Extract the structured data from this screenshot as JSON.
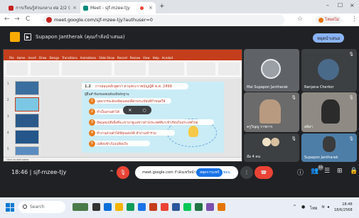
{
  "browser": {
    "tabs": [
      {
        "title": "การเรียนรู้ส่วนกลาง ต่อ 2/2 (ส่ว",
        "active": false,
        "close": "×"
      },
      {
        "title": "Meet - sjf-mzee-tjy",
        "active": true,
        "close": "×"
      }
    ],
    "new_tab": "+",
    "window_controls": {
      "minimize": "–",
      "maximize": "☐",
      "close": "×"
    },
    "back": "←",
    "forward": "→",
    "reload": "C",
    "url": "meet.google.com/sjf-mzee-tjy?authuser=0",
    "star": "☆",
    "profile_label": "โหมดไม่",
    "menu": "⋮"
  },
  "banner": {
    "presenter_text": "Supapon Jantherak (คุณกำลังนำเสนอ)",
    "stop_button": "หยุดนำเสนอ"
  },
  "presentation": {
    "window_title": "",
    "ribbon_tabs": [
      "File",
      "Home",
      "Insert",
      "Draw",
      "Design",
      "Transitions",
      "Animations",
      "Slide Show",
      "Record",
      "Review",
      "View",
      "Help",
      "Acrobat"
    ],
    "slide_number": "1.2",
    "slide_title": "การสอบหลักสูตรฯ ตามพระราชบัญญัติ พ.ศ. 2499",
    "slide_subtitle": "ผู้ยื่นคำร้องขอสอบต้องมีหลักฐาน",
    "items": [
      {
        "num": "1",
        "text": "บุคลากรจะต้องมีคุณสมบัติตามระเบียบที่กำหนดให้"
      },
      {
        "num": "2",
        "text": "ทำเป็นส่วนตัวได้"
      },
      {
        "num": "3",
        "text": "มีคุณสมบัติเพื่อที่จะเขามาดูแลชาวต่างประเทศที่มาเข้าเรียนในประเทศไทย"
      },
      {
        "num": "4",
        "text": "ทำงานส่วนตัวได้มีคุณสมบัติ ทำงานเข้าร่วม"
      },
      {
        "num": "5",
        "text": "เปลี่ยนข้างไม่เปลี่ยนใจ"
      }
    ],
    "status_text": "Click to add notes",
    "thumb_numbers": [
      "1",
      "2",
      "3",
      "4",
      "5"
    ]
  },
  "participants": [
    {
      "name": "Mai Supapon Jantharak"
    },
    {
      "name": "Ranjana Cherkor"
    },
    {
      "name": "ครูวิญญู ราชการ"
    },
    {
      "name": "สลิสา"
    },
    {
      "name": "อ๊อ 4 คน"
    },
    {
      "name": "Supapon Jantharak"
    }
  ],
  "meeting": {
    "time": "18:46",
    "separator": "|",
    "code": "sjf-mzee-tjy",
    "popup_text": "meet.google.com กำลังแชร์หน้าจอ",
    "popup_button": "หยุดการแชร์",
    "popup_hide": "ซ่อน",
    "participant_count": "10"
  },
  "taskbar": {
    "search_placeholder": "Search",
    "tray_text": "ไทย",
    "time": "18:46",
    "date": "18/6/2568"
  },
  "colors": {
    "accent": "#8ab4f8",
    "end_call": "#ea4335",
    "ppt_red": "#c43e1c",
    "slide_bg": "#c9ecf6",
    "item_num": "#e67e22"
  }
}
